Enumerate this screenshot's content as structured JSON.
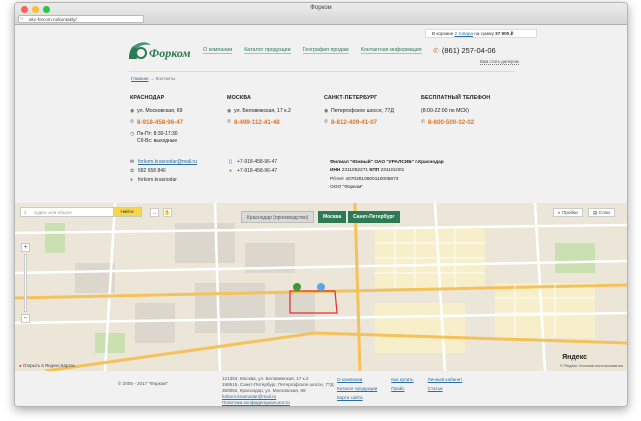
{
  "browser": {
    "title": "Форком",
    "url": "akc-forcom.ru/kontakty/"
  },
  "header": {
    "cart_prefix": "В корзине",
    "cart_link": "2 товара",
    "cart_sum_label": "на сумму",
    "cart_sum": "37 900 ₽",
    "logo_text": "Форком",
    "nav": [
      "О компании",
      "Каталог продукции",
      "География продаж",
      "Контактная информация"
    ],
    "phone": "(861) 257-04-06",
    "callback": "Вам стать дилером"
  },
  "breadcrumb": {
    "home": "Главная",
    "separator": "→",
    "current": "Контакты"
  },
  "offices": [
    {
      "city": "КРАСНОДАР",
      "address": "ул. Московская, 69",
      "phone": "8-918-458-96-47",
      "hours_1": "Пн-Пт: 8:30-17:30",
      "hours_2": "Сб-Вс: выходные"
    },
    {
      "city": "МОСКВА",
      "address": "ул. Беловежская, 17 к.2",
      "phone": "8-499-112-41-48"
    },
    {
      "city": "САНКТ-ПЕТЕРБУРГ",
      "address": "Петергофское шоссе, 77Д",
      "phone": "8-812-409-41-07"
    },
    {
      "city": "БЕСПЛАТНЫЙ ТЕЛЕФОН",
      "address": "(8:00-22:00 по МСК)",
      "phone": "8-800-500-32-02"
    }
  ],
  "contacts": {
    "email": "forkom.krasnodar@mail.ru",
    "icq": "682 658 846",
    "skype": "forkom.krasnodar",
    "phone_1": "+7-918-458-96-47",
    "phone_2": "+7-918-458-96-47"
  },
  "requisites": {
    "branch": "Филиал \"Южный\" ОАО \"УРАЛСИБ\" г.Краснодар",
    "inn_label": "ИНН",
    "inn": "2311062271",
    "kpp_label": "КПП",
    "kpp": "231101001",
    "account": "Р/счет 40702810600110005873",
    "company": "ООО \"Форком\""
  },
  "map": {
    "search_placeholder": "Адрес или объект",
    "find_button": "Найти",
    "tab_1": "Краснодар (производство)",
    "tab_2": "Москва",
    "tab_3": "Санкт-Петербург",
    "traffic_label": "Пробки",
    "layers_label": "Слои",
    "open_in_yandex": "Открыть в Яндекс.Картах",
    "terms": "© Яндекс Условия использования",
    "brand": "Яндекс"
  },
  "footer": {
    "copyright": "© 2005 - 2017 \"Форком\"",
    "address_1": "121353, Москва, ул. Беловежская, 17 к.2",
    "address_2": "198515, Санкт-Петербург, Петергофское шоссе, 77Д",
    "address_3": "350062, Краснодар, ул. Московская, 69",
    "email": "forkom.krasnodar@mail.ru",
    "privacy": "Политика конфиденциальности",
    "links": [
      "О компании",
      "Как купить",
      "Личный кабинет",
      "Каталог продукции",
      "Прайс",
      "Статьи",
      "Карта сайта"
    ]
  },
  "colors": {
    "accent_orange": "#e27420",
    "brand_green": "#2d7a55",
    "link_blue": "#2b6ea6"
  }
}
